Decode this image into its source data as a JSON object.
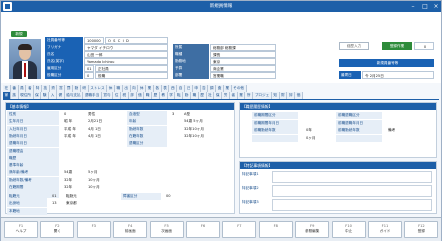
{
  "window": {
    "title": "新規員情報"
  },
  "header": {
    "badge": "新規",
    "staff_no_label": "社員番号等",
    "staff_no": "100000",
    "staff_code": "O S C I D",
    "kana_label": "フリガナ",
    "kana": "ヤマダ イチロウ",
    "name_label": "氏名",
    "name": "山田 一郎",
    "roman_label": "氏名(英字)",
    "roman": "Yamada Ichirou",
    "emp_type_label": "雇用区分",
    "emp_type_code": "01",
    "emp_type": "正社員",
    "role_label": "役職区分",
    "role_code": "0",
    "role": "役職",
    "dept_label": "所属",
    "dept": "総務部 総務課",
    "grade_label": "職種",
    "grade": "課長",
    "location_label": "勤務地",
    "location": "東京",
    "reserve_label": "予算",
    "reserve": "商企業",
    "section_label": "部署",
    "section": "営業職",
    "btn_hist": "経歴入力",
    "btn_reg": "登録作業",
    "reg_badge": "0",
    "new_info_btn": "新規員番号等",
    "join_label": "最寄日",
    "join_value": "令 2月25日"
  },
  "tabs_row1": [
    "在",
    "番",
    "員",
    "者",
    "特",
    "技",
    "資",
    "賞",
    "罰",
    "勤",
    "研",
    "ストレス",
    "休",
    "職",
    "出",
    "向",
    "休",
    "業",
    "各",
    "表",
    "西",
    "自",
    "己",
    "申",
    "告",
    "調",
    "査",
    "業",
    "その他"
  ],
  "tabs_row2": [
    "家",
    "族",
    "現住所",
    "保",
    "験",
    "入",
    "健",
    "給与支払",
    "退職手当",
    "賞与",
    "住",
    "税",
    "評",
    "価",
    "職",
    "歴",
    "教",
    "学",
    "転",
    "勤",
    "職",
    "歴",
    "社",
    "保",
    "労",
    "者",
    "業",
    "所",
    "プロジェ",
    "知",
    "財",
    "評",
    "価"
  ],
  "tabs_row2_active": 0,
  "basic": {
    "title": "【基本情報】",
    "rows": [
      {
        "k": "性別",
        "v1": "0",
        "v2": "男性"
      },
      {
        "k": "生年月日",
        "v1": "昭 年",
        "v2": "2月21日"
      },
      {
        "k": "入社年月日",
        "v1": "平成 年",
        "v2": "4月 1日"
      },
      {
        "k": "勤続年月日",
        "v1": "平成 年",
        "v2": "4月 1日"
      },
      {
        "k": "退職年月日",
        "v1": "",
        "v2": ""
      },
      {
        "k": "退職理由",
        "v1": "",
        "v2": ""
      },
      {
        "k": "職歴",
        "v1": "",
        "v2": ""
      },
      {
        "k": "基準年齢",
        "v1": "",
        "v2": ""
      },
      {
        "k": "満年齢/備考",
        "v1": "54歳",
        "v2": "5ヶ月"
      },
      {
        "k": "勤続年数/備考",
        "v1": "32年",
        "v2": "10ヶ月"
      },
      {
        "k": "在籍期間",
        "v1": "32年",
        "v2": "10ヶ月"
      },
      {
        "k": "",
        "v1": "",
        "v2": ""
      }
    ],
    "right_rows": [
      {
        "k": "血液型",
        "v1": "3",
        "v2": "A型"
      },
      {
        "k": "年齢",
        "v1": "",
        "v2": "54歳 5ヶ月"
      },
      {
        "k": "勤続年数",
        "v1": "",
        "v2": "32年10ヶ月"
      },
      {
        "k": "在籍年数",
        "v1": "",
        "v2": "32年10ヶ月"
      },
      {
        "k": "退職区分",
        "v1": "",
        "v2": ""
      }
    ],
    "bottom": [
      {
        "k": "転籍元",
        "code": "01",
        "v": "転勤元"
      },
      {
        "k": "出身地",
        "code": "13",
        "v": "東京都"
      },
      {
        "k": "本籍地",
        "code": "",
        "v": ""
      }
    ],
    "bottom_right": {
      "k": "障害区分",
      "code": "00",
      "v": ""
    }
  },
  "career": {
    "title": "【職歴履歴情報】",
    "headers": [
      "",
      "前職期間",
      "",
      "前職退職年月日"
    ],
    "rows": [
      {
        "a": "前職期間区分",
        "b": "",
        "c": "前職退職区分",
        "d": ""
      },
      {
        "a": "前職期間年月日",
        "b": "",
        "c": "前職退職年月日",
        "d": ""
      },
      {
        "a": "前職勤続年数",
        "b": "0年",
        "c": "前職勤続年数",
        "d": "備考"
      },
      {
        "a": "",
        "b": "0ヶ月",
        "c": "",
        "d": ""
      }
    ]
  },
  "memo": {
    "title": "【特記事項情報】",
    "labels": [
      "特記事項1",
      "特記事項2",
      "特記事項3"
    ]
  },
  "fkeys": [
    {
      "n": "F1",
      "l": "ヘルプ"
    },
    {
      "n": "F2",
      "l": "開く"
    },
    {
      "n": "F3",
      "l": ""
    },
    {
      "n": "F4",
      "l": "前画面"
    },
    {
      "n": "F5",
      "l": "次画面"
    },
    {
      "n": "F6",
      "l": ""
    },
    {
      "n": "F7",
      "l": ""
    },
    {
      "n": "F8",
      "l": ""
    },
    {
      "n": "F9",
      "l": "参照編集"
    },
    {
      "n": "F10",
      "l": "中止"
    },
    {
      "n": "F11",
      "l": "ガイド"
    },
    {
      "n": "F12",
      "l": "登録"
    }
  ]
}
